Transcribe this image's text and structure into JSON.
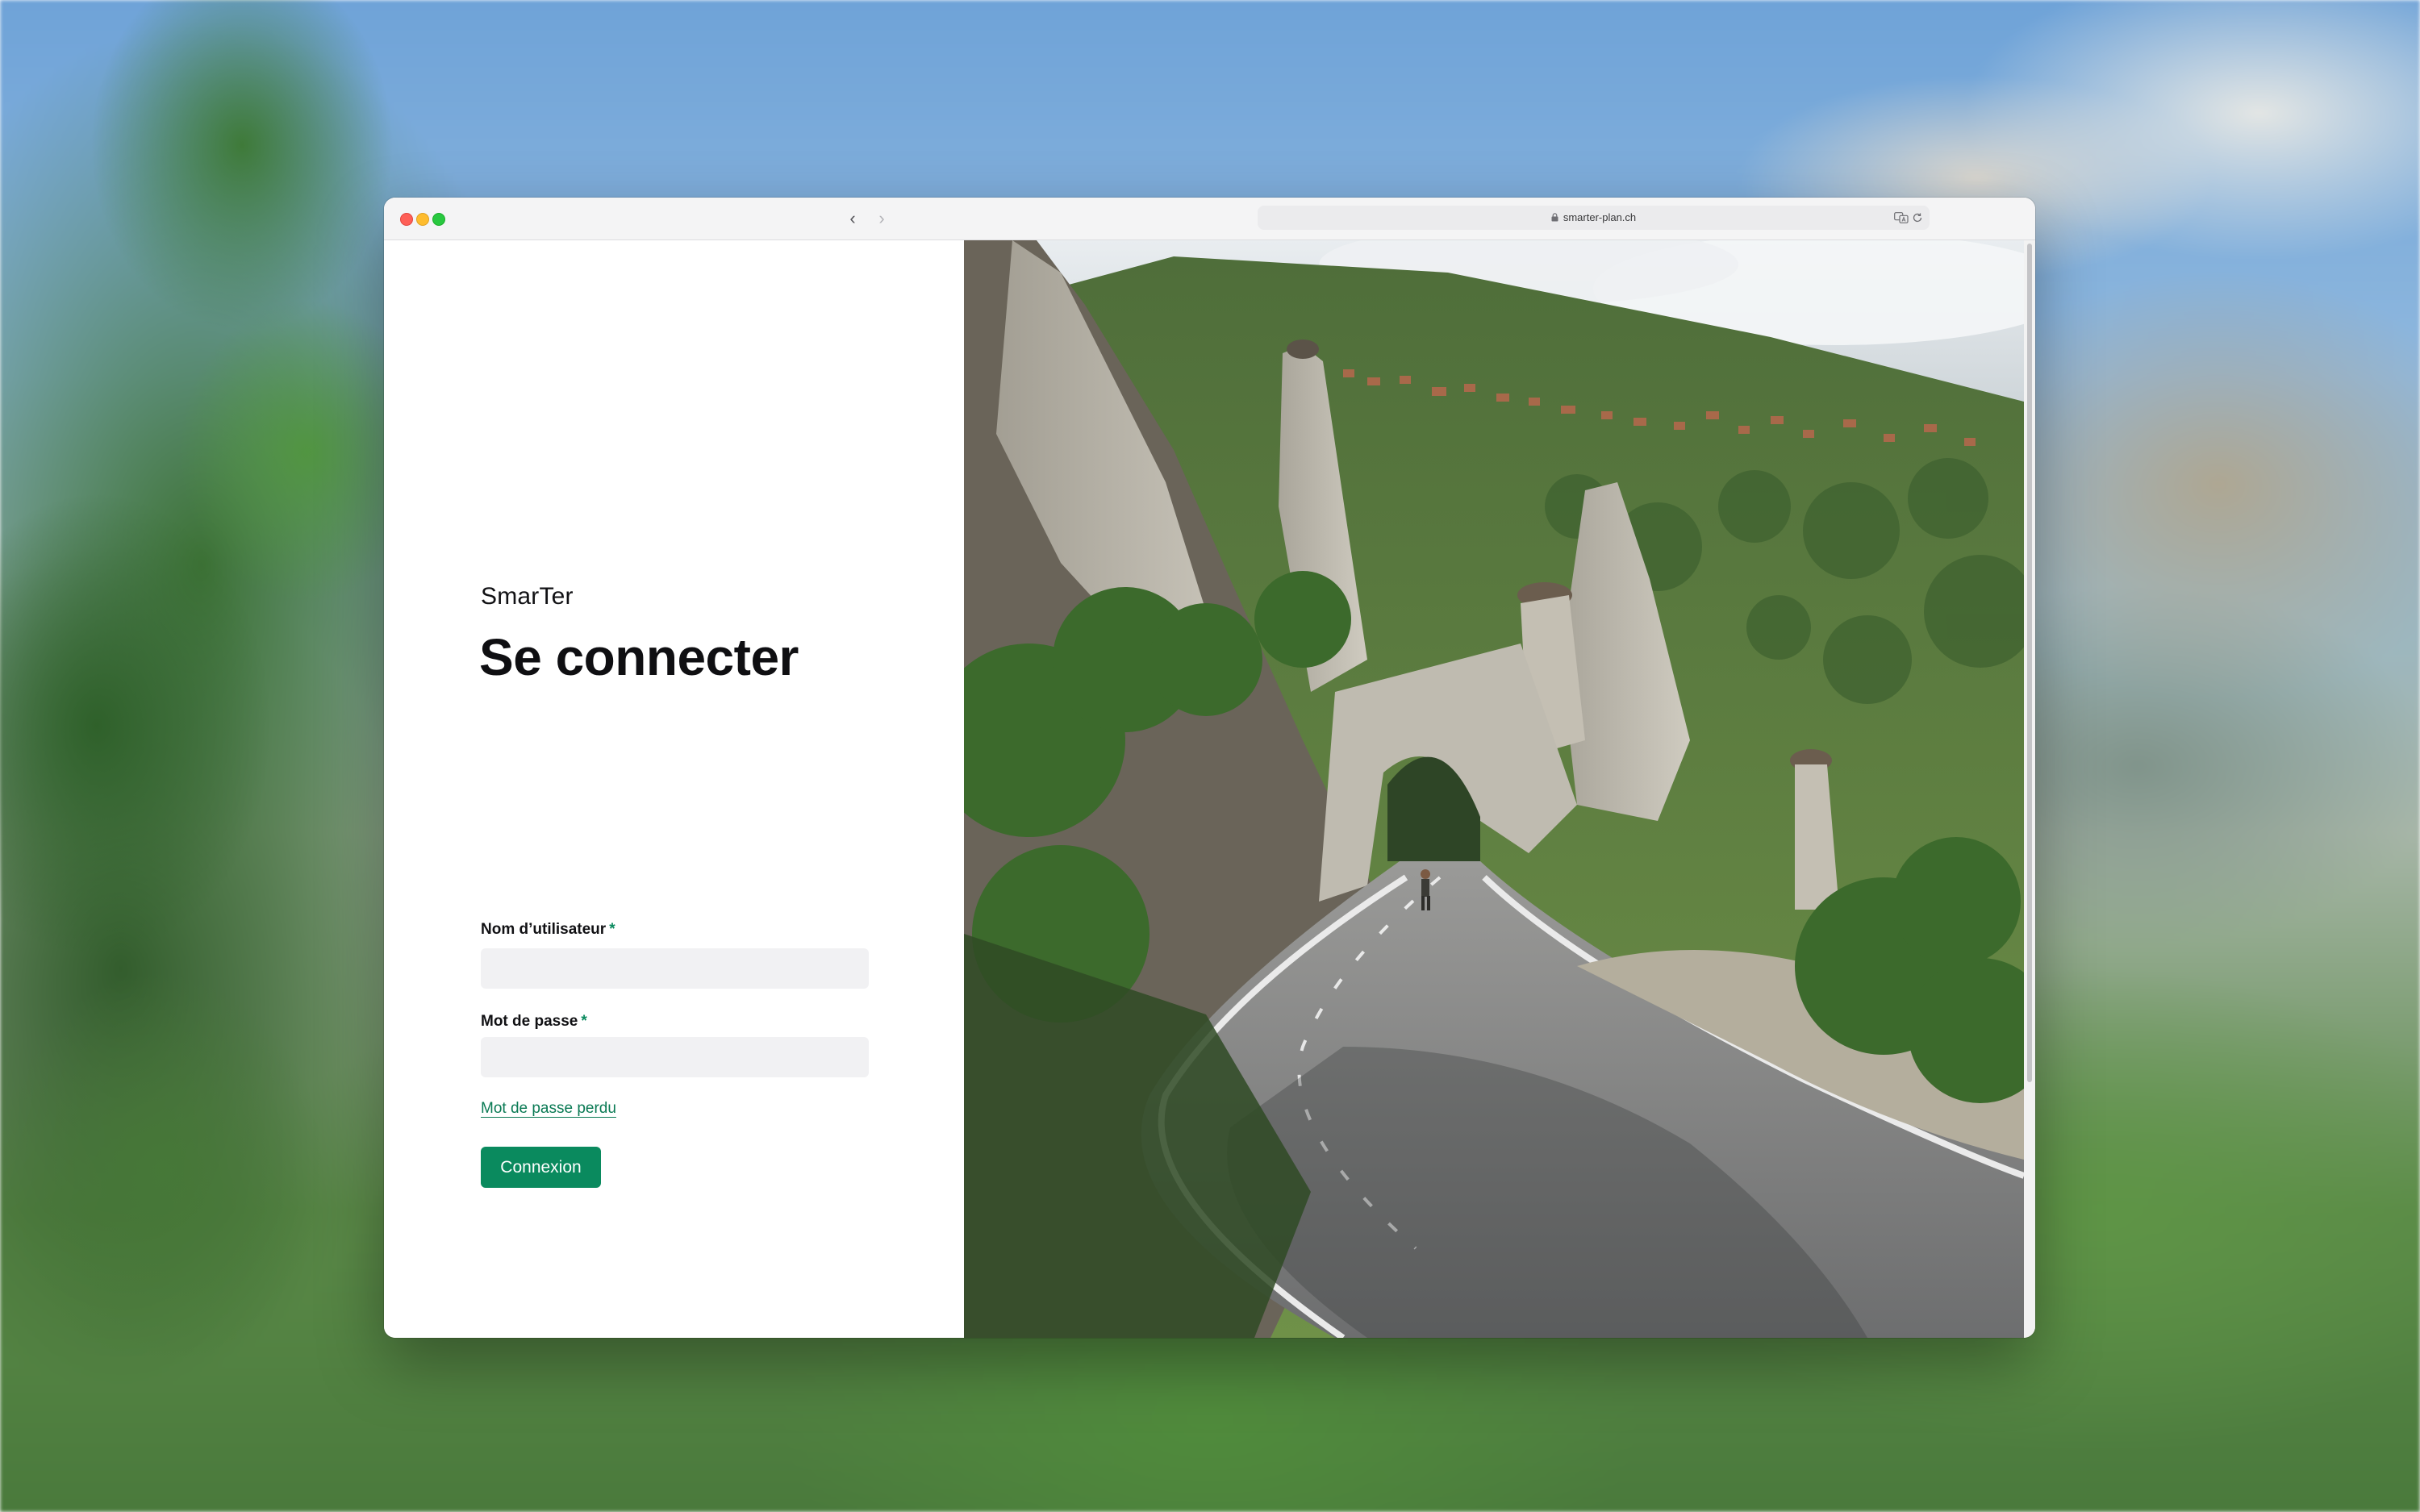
{
  "browser": {
    "url": "smarter-plan.ch",
    "back_glyph": "‹",
    "forward_glyph": "›"
  },
  "login": {
    "brand": "SmarTer",
    "heading": "Se connecter",
    "username_label": "Nom d’utilisateur",
    "password_label": "Mot de passe",
    "required_marker": "*",
    "forgot_link": "Mot de passe perdu",
    "submit_label": "Connexion"
  },
  "colors": {
    "accent": "#0a8a5e",
    "link": "#0a7a54",
    "field_bg": "#f1f1f3"
  },
  "icons": [
    "lock-icon",
    "translate-icon",
    "reload-icon",
    "chevron-left-icon",
    "chevron-right-icon"
  ]
}
